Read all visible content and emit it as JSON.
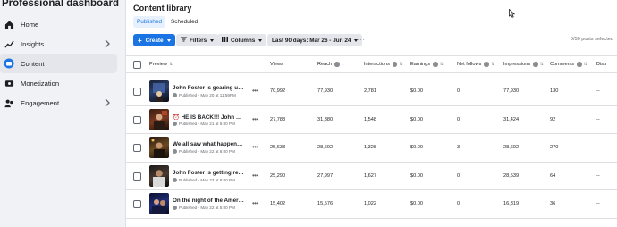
{
  "sidebar": {
    "title": "Professional dashboard",
    "items": [
      {
        "label": "Home"
      },
      {
        "label": "Insights"
      },
      {
        "label": "Content"
      },
      {
        "label": "Monetization"
      },
      {
        "label": "Engagement"
      }
    ]
  },
  "main": {
    "title": "Content library",
    "tabs": [
      {
        "label": "Published"
      },
      {
        "label": "Scheduled"
      }
    ],
    "toolbar": {
      "create_label": "Create",
      "filters_label": "Filters",
      "columns_label": "Columns",
      "date_label": "Last 90 days: Mar 26 - Jun 24",
      "more_label": "···",
      "posts_selected": "0/50 posts selected"
    },
    "columns": [
      "Preview",
      "Views",
      "Reach",
      "Interactions",
      "Earnings",
      "Net follows",
      "Impressions",
      "Comments",
      "Distr"
    ],
    "rows": [
      {
        "title": "John Foster is gearing up to ...",
        "meta": "Published • May 20 at 11:59PM",
        "views": "70,992",
        "reach": "77,930",
        "interactions": "2,781",
        "earnings": "$0.00",
        "net_follows": "0",
        "impressions": "77,930",
        "comments": "130",
        "distr": "--"
      },
      {
        "title": "⏰ HE IS BACK!!! John Foste...",
        "meta": "Published • May 21 at 5:00 PM",
        "views": "27,783",
        "reach": "31,380",
        "interactions": "1,548",
        "earnings": "$0.00",
        "net_follows": "0",
        "impressions": "31,424",
        "comments": "92",
        "distr": "--"
      },
      {
        "title": "We all saw what happened ...",
        "meta": "Published • May 22 at 6:00 PM",
        "views": "25,638",
        "reach": "28,692",
        "interactions": "1,328",
        "earnings": "$0.00",
        "net_follows": "3",
        "impressions": "28,692",
        "comments": "270",
        "distr": "--"
      },
      {
        "title": "John Foster is getting ready ...",
        "meta": "Published • May 23 at 8:00 PM",
        "views": "25,290",
        "reach": "27,997",
        "interactions": "1,627",
        "earnings": "$0.00",
        "net_follows": "0",
        "impressions": "28,539",
        "comments": "64",
        "distr": "--"
      },
      {
        "title": "On the night of the America...",
        "meta": "Published • May 22 at 5:00 PM",
        "views": "15,402",
        "reach": "15,576",
        "interactions": "1,022",
        "earnings": "$0.00",
        "net_follows": "0",
        "impressions": "16,319",
        "comments": "36",
        "distr": "--"
      }
    ]
  },
  "colors": {
    "accent": "#1b74e4",
    "background": "#f0f2f5",
    "panel": "#ffffff",
    "active_nav": "#e4e6eb"
  }
}
